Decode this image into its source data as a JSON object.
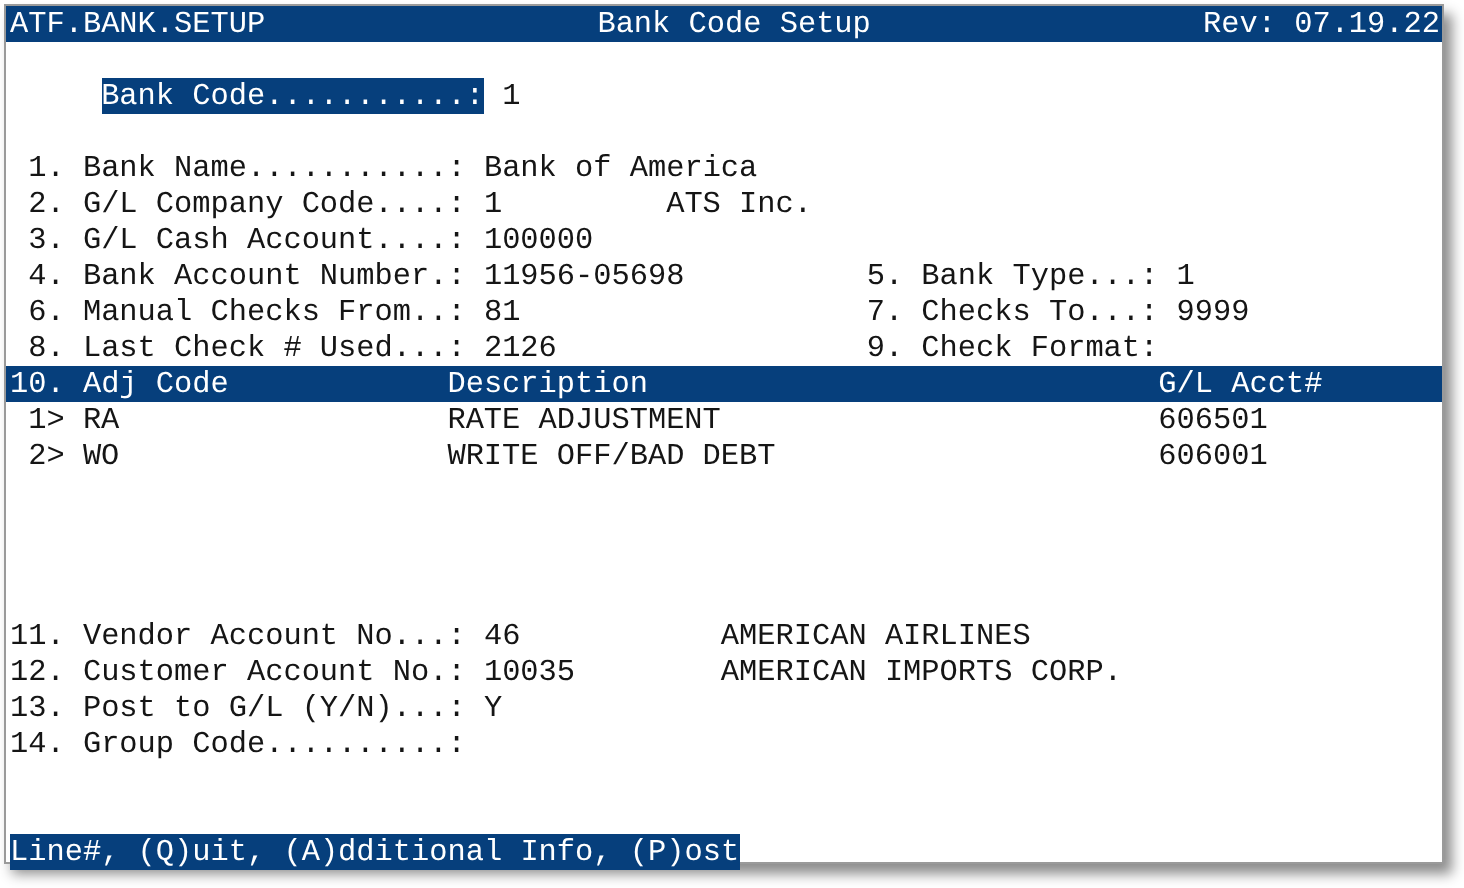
{
  "title_bar": {
    "program": "ATF.BANK.SETUP",
    "title": "Bank Code Setup",
    "revision": "Rev: 07.19.22"
  },
  "bank_code": {
    "label": "Bank Code...........:",
    "value": "1",
    "selected": true
  },
  "fields": [
    {
      "number": "1.",
      "label": "Bank Name...........:",
      "value": "Bank of America"
    },
    {
      "number": "2.",
      "label": "G/L Company Code....:",
      "value": "1",
      "note": "ATS Inc."
    },
    {
      "number": "3.",
      "label": "G/L Cash Account....:",
      "value": "100000"
    },
    {
      "number": "4.",
      "label": "Bank Account Number.:",
      "value": "11956-05698",
      "right": {
        "number": "5.",
        "label": "Bank Type...:",
        "value": "1"
      }
    },
    {
      "number": "6.",
      "label": "Manual Checks From..:",
      "value": "81",
      "right": {
        "number": "7.",
        "label": "Checks To...:",
        "value": "9999"
      }
    },
    {
      "number": "8.",
      "label": "Last Check # Used...:",
      "value": "2126",
      "right": {
        "number": "9.",
        "label": "Check Format:"
      }
    }
  ],
  "adjustments": {
    "number": "10.",
    "columns": [
      "Adj Code",
      "Description",
      "G/L Acct#"
    ],
    "rows": [
      {
        "line": "1>",
        "code": "RA",
        "description": "RATE ADJUSTMENT",
        "account": "606501"
      },
      {
        "line": "2>",
        "code": "WO",
        "description": "WRITE OFF/BAD DEBT",
        "account": "606001"
      }
    ]
  },
  "more_fields": [
    {
      "number": "11.",
      "label": "Vendor Account No...:",
      "value": "46",
      "name": "AMERICAN AIRLINES"
    },
    {
      "number": "12.",
      "label": "Customer Account No.:",
      "value": "10035",
      "name": "AMERICAN IMPORTS CORP."
    },
    {
      "number": "13.",
      "label": "Post to G/L (Y/N)...:",
      "value": "Y"
    },
    {
      "number": "14.",
      "label": "Group Code..........:"
    }
  ],
  "status_bar": {
    "prompt": "Line#, (Q)uit, (A)dditional Info, (P)ost"
  }
}
